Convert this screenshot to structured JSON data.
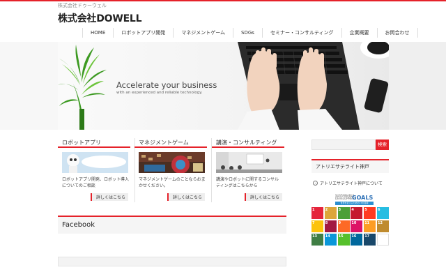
{
  "header": {
    "tagline": "株式会社ドゥーウェル",
    "site_title": "株式会社DOWELL"
  },
  "nav": {
    "items": [
      "HOME",
      "ロボットアプリ開発",
      "マネジメントゲーム",
      "SDGs",
      "セミナー・コンサルティング",
      "企業概要",
      "お問合わせ"
    ]
  },
  "hero": {
    "title": "Accelerate your business",
    "subtitle": "with an experienced and reliable technology."
  },
  "cards": [
    {
      "title": "ロボットアプリ",
      "text": "ロボットアプリ開発、ロボット導入についてのご相談",
      "more": "詳しくはこちら"
    },
    {
      "title": "マネジメントゲーム",
      "text": "マネジメントゲームのことならおまかせください。",
      "more": "詳しくはこちら"
    },
    {
      "title": "講演・コンサルティング",
      "text": "講演やロボットに関するコンサルティングはこちらから",
      "more": "詳しくはこちら"
    }
  ],
  "facebook": {
    "title": "Facebook"
  },
  "sidebar": {
    "search_button": "検索",
    "heading": "アトリエサテライト神戸",
    "link": "アトリエサテライト神戸について"
  },
  "sdgs": {
    "banner_small": "SUSTAINABLE DEVELOPMENT",
    "banner_goals": "GOALS",
    "banner_strip": "世界を変えるための17の目標",
    "tiles": [
      {
        "n": "1",
        "c": "#e5243b"
      },
      {
        "n": "2",
        "c": "#dda63a"
      },
      {
        "n": "3",
        "c": "#4c9f38"
      },
      {
        "n": "4",
        "c": "#c5192d"
      },
      {
        "n": "5",
        "c": "#ff3a21"
      },
      {
        "n": "6",
        "c": "#26bde2"
      },
      {
        "n": "7",
        "c": "#fcc30b"
      },
      {
        "n": "8",
        "c": "#a21942"
      },
      {
        "n": "9",
        "c": "#fd6925"
      },
      {
        "n": "10",
        "c": "#dd1367"
      },
      {
        "n": "11",
        "c": "#fd9d24"
      },
      {
        "n": "12",
        "c": "#bf8b2e"
      },
      {
        "n": "13",
        "c": "#3f7e44"
      },
      {
        "n": "14",
        "c": "#0a97d9"
      },
      {
        "n": "15",
        "c": "#56c02b"
      },
      {
        "n": "16",
        "c": "#00689d"
      },
      {
        "n": "17",
        "c": "#19486a"
      },
      {
        "n": "",
        "c": "#ffffff"
      }
    ]
  },
  "colors": {
    "accent": "#e5222a"
  }
}
